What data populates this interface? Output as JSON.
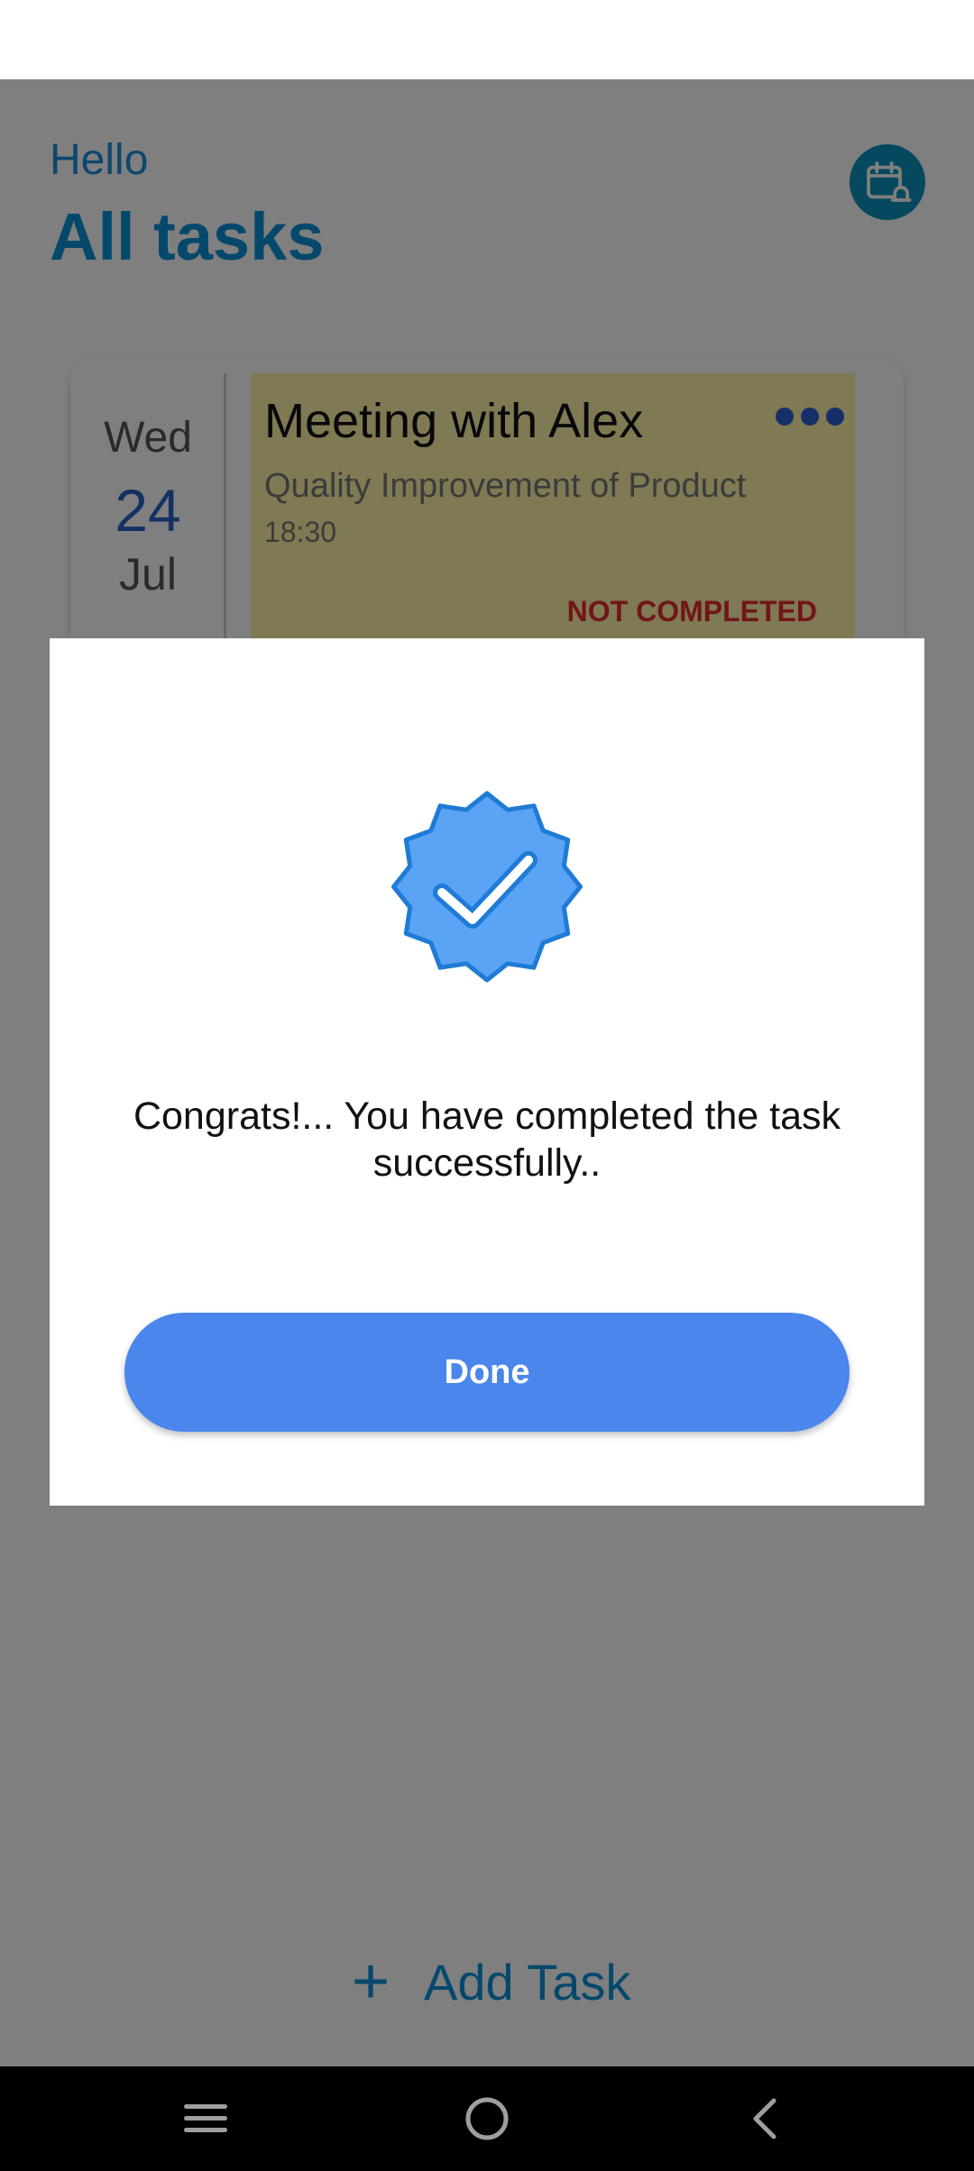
{
  "header": {
    "greeting": "Hello",
    "title": "All tasks",
    "calendar_icon": "calendar-bell-icon"
  },
  "task": {
    "weekday": "Wed",
    "day": "24",
    "month": "Jul",
    "title": "Meeting with Alex",
    "description": "Quality Improvement of Product",
    "time": "18:30",
    "status": "NOT COMPLETED",
    "card_color": "#fef3a8",
    "status_color": "#e32a35",
    "more_icon": "more-horizontal-icon"
  },
  "add_task": {
    "label": "Add Task",
    "icon": "plus-icon"
  },
  "dialog": {
    "icon": "verified-badge-icon",
    "message": "Congrats!... You have completed the task successfully..",
    "button_label": "Done",
    "button_color": "#4a86eb"
  },
  "nav": {
    "menu_icon": "menu-icon",
    "home_icon": "home-circle-icon",
    "back_icon": "back-chevron-icon"
  },
  "colors": {
    "accent": "#0a90d8",
    "scrim": "rgba(0,0,0,0.5)"
  }
}
